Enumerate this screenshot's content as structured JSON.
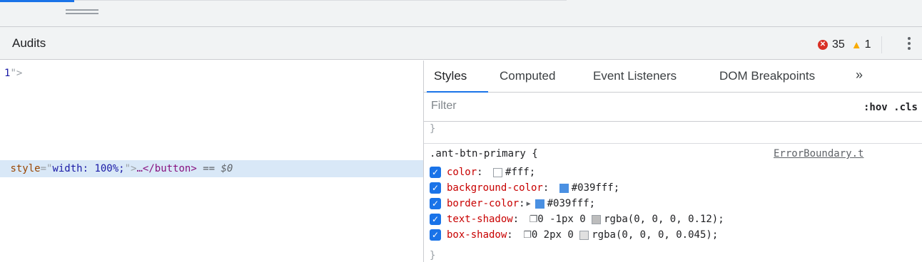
{
  "drawer": {
    "title": "Audits",
    "error_count": "35",
    "warning_count": "1"
  },
  "elements": {
    "line1_value": "1",
    "line1_close": "\">",
    "selected": {
      "attr_name": "style",
      "attr_eq": "=\"",
      "attr_value": "width: 100%;",
      "attr_close": "\">",
      "ellipsis": "…",
      "close_tag": "</button>",
      "equals": " == ",
      "dollar": "$0"
    }
  },
  "sidebar": {
    "tabs": [
      "Styles",
      "Computed",
      "Event Listeners",
      "DOM Breakpoints"
    ],
    "more": "»",
    "filter_placeholder": "Filter",
    "hov": ":hov",
    "cls": ".cls",
    "prev_brace": "}",
    "rule": {
      "selector": ".ant-btn-primary",
      "open_brace": " {",
      "source": "ErrorBoundary.t",
      "declarations": [
        {
          "prop": "color",
          "value": "#fff;",
          "swatch": "#ffffff"
        },
        {
          "prop": "background-color",
          "value": "#039fff;",
          "swatch": "#4a90e2"
        },
        {
          "prop": "border-color",
          "value": "#039fff;",
          "swatch": "#4a90e2"
        },
        {
          "prop": "text-shadow",
          "value": "0 -1px 0 ",
          "swatch": "#bdbdbd",
          "value2": "rgba(0, 0, 0, 0.12);"
        },
        {
          "prop": "box-shadow",
          "value": "0 2px 0 ",
          "swatch": "#e0e0e0",
          "value2": "rgba(0, 0, 0, 0.045);"
        }
      ],
      "close_brace": "}"
    }
  },
  "colors": {
    "accent": "#1a73e8",
    "error": "#d93025",
    "warning": "#f9ab00",
    "selection": "#d9e8f7"
  }
}
